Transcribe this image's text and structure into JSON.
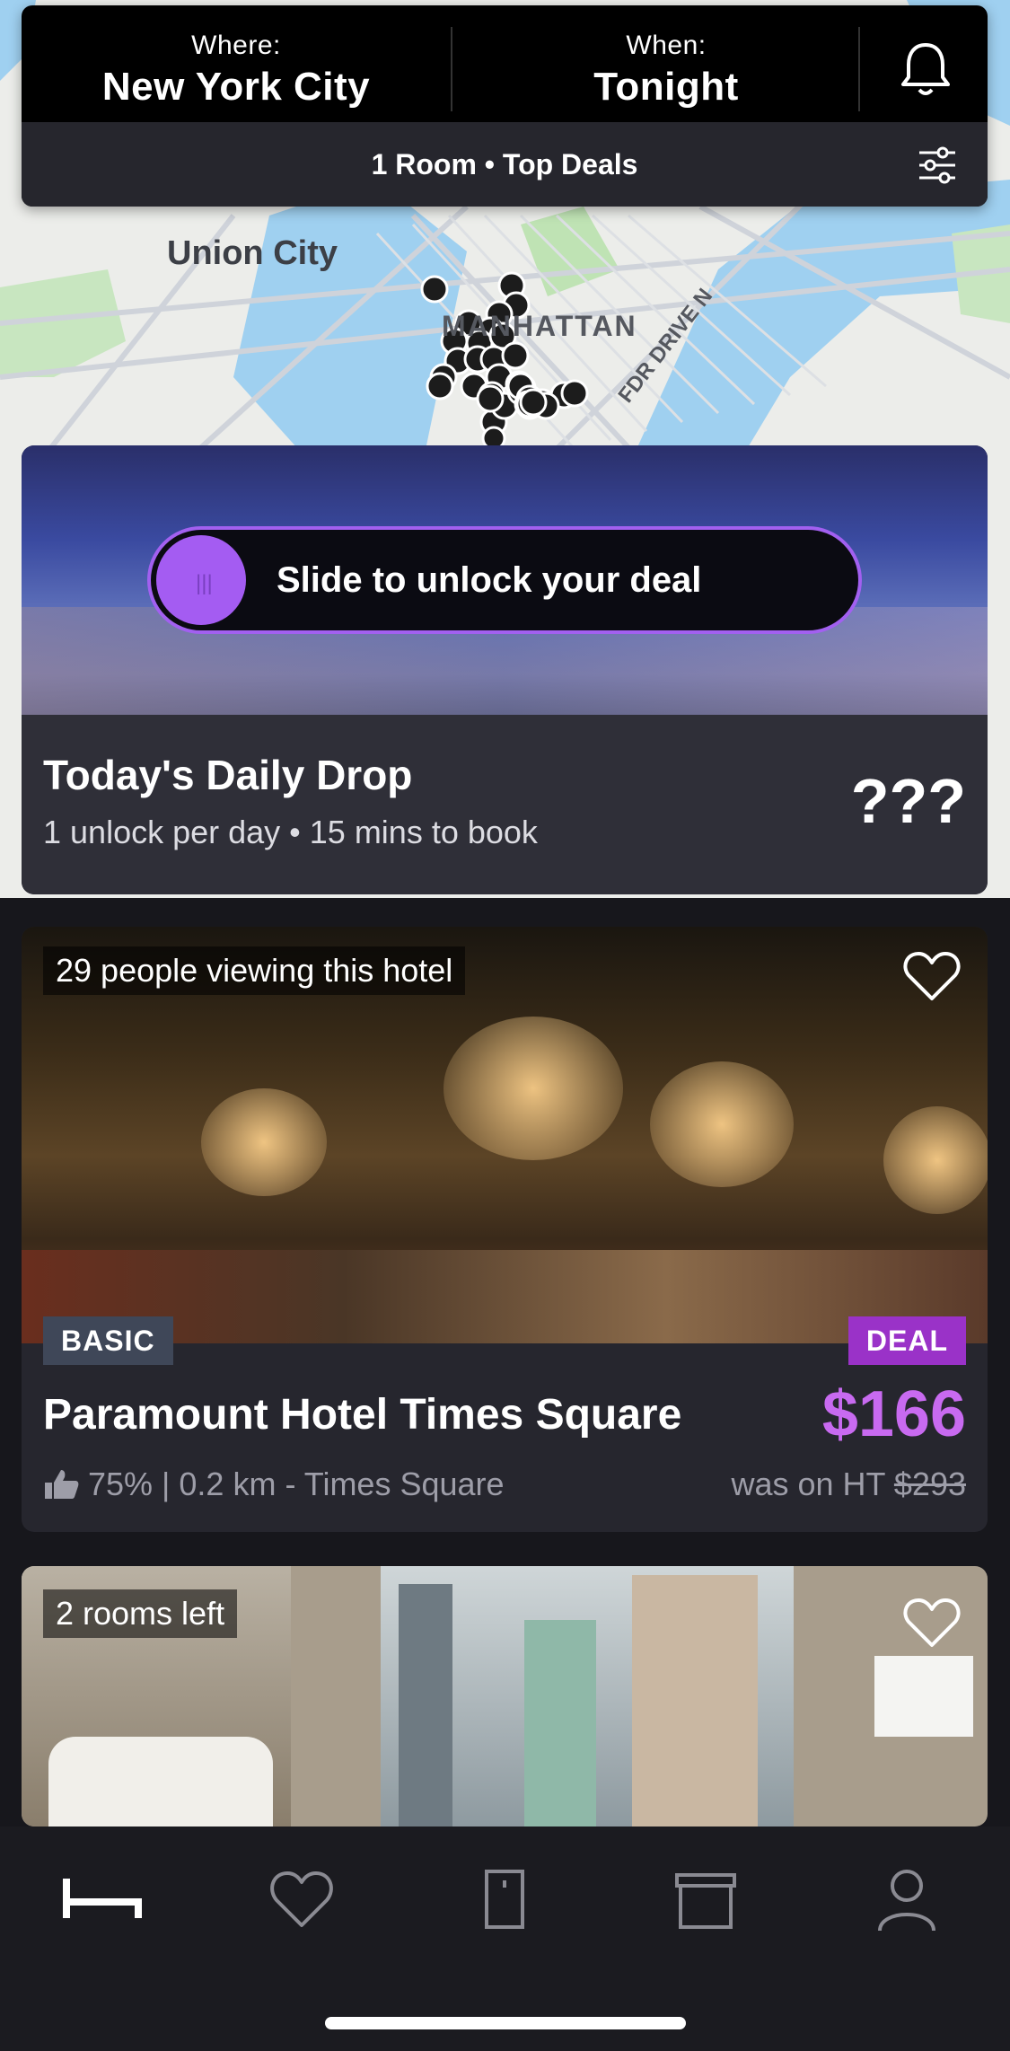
{
  "header": {
    "where_label": "Where:",
    "where_value": "New York City",
    "when_label": "When:",
    "when_value": "Tonight",
    "filter_summary": "1 Room • Top Deals"
  },
  "map": {
    "labels": {
      "union_city": "Union City",
      "manhattan": "MANHATTAN",
      "fdr": "FDR DRIVE N"
    }
  },
  "daily_drop": {
    "slider_text": "Slide to unlock your deal",
    "title": "Today's Daily Drop",
    "subtitle": "1 unlock per day • 15 mins to book",
    "price": "???"
  },
  "hotels": [
    {
      "viewing": "29 people viewing this hotel",
      "tier": "BASIC",
      "deal_badge": "DEAL",
      "name": "Paramount Hotel Times Square",
      "price": "$166",
      "rating_distance": "75% | 0.2 km - Times Square",
      "was_prefix": "was on HT",
      "was_price": "$293"
    },
    {
      "viewing": "2 rooms left"
    }
  ],
  "tabs": [
    "bed-icon",
    "heart-icon",
    "bookings-icon",
    "gift-icon",
    "profile-icon"
  ],
  "colors": {
    "accent_purple": "#a45cf2",
    "price_purple": "#c86af0",
    "deal_badge": "#9a32c8"
  }
}
